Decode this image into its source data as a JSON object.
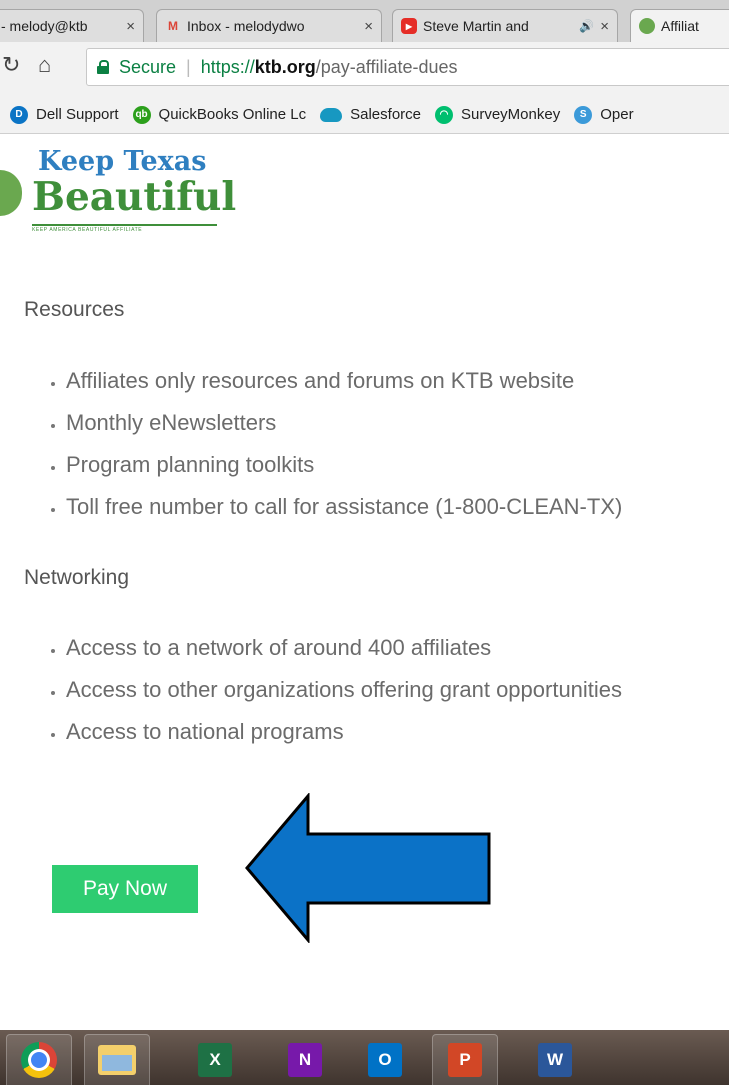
{
  "browser": {
    "tabs": [
      {
        "title": "- melody@ktb",
        "icon": "page-icon",
        "close": "×"
      },
      {
        "title": "Inbox - melodydwo",
        "icon": "gmail-icon",
        "close": "×"
      },
      {
        "title": "Steve Martin and",
        "icon": "youtube-icon",
        "audio": "🔊",
        "close": "×"
      },
      {
        "title": "Affiliat",
        "icon": "globe-icon"
      }
    ],
    "address_bar": {
      "security_label": "Secure",
      "url_scheme": "https://",
      "url_host": "ktb.org",
      "url_path": "/pay-affiliate-dues"
    },
    "bookmarks": [
      {
        "label": "Dell Support",
        "icon": "dell-icon",
        "color": "#0b74c5"
      },
      {
        "label": "QuickBooks Online Lc",
        "icon": "quickbooks-icon",
        "color": "#2ca01c"
      },
      {
        "label": "Salesforce",
        "icon": "salesforce-cloud-icon",
        "color": "#1798c1"
      },
      {
        "label": "SurveyMonkey",
        "icon": "surveymonkey-icon",
        "color": "#00bf6f"
      },
      {
        "label": "Oper",
        "icon": "open-icon",
        "color": "#3b9ad9"
      }
    ]
  },
  "page": {
    "logo": {
      "line1": "Keep Texas",
      "line2": "Beautiful",
      "tagline": "KEEP AMERICA BEAUTIFUL AFFILIATE"
    },
    "sections": [
      {
        "title": "Resources",
        "items": [
          "Affiliates only resources and forums on KTB website",
          "Monthly eNewsletters",
          "Program planning toolkits",
          "Toll free number to call for assistance (1-800-CLEAN-TX)"
        ]
      },
      {
        "title": "Networking",
        "items": [
          "Access to a network of around 400 affiliates",
          "Access to other organizations offering grant opportunities",
          "Access to national programs"
        ]
      }
    ],
    "pay_button_label": "Pay Now"
  },
  "taskbar": {
    "apps": [
      {
        "name": "chrome-icon"
      },
      {
        "name": "file-explorer-icon"
      },
      {
        "name": "excel-icon",
        "letter": "X",
        "color": "#1e7145"
      },
      {
        "name": "onenote-icon",
        "letter": "N",
        "color": "#7719aa"
      },
      {
        "name": "outlook-icon",
        "letter": "O",
        "color": "#0072c6"
      },
      {
        "name": "powerpoint-icon",
        "letter": "P",
        "color": "#d24726"
      },
      {
        "name": "word-icon",
        "letter": "W",
        "color": "#2b579a"
      }
    ]
  },
  "colors": {
    "button_green": "#2ecc71",
    "arrow_blue": "#0b72c7",
    "secure_green": "#0b8043"
  }
}
